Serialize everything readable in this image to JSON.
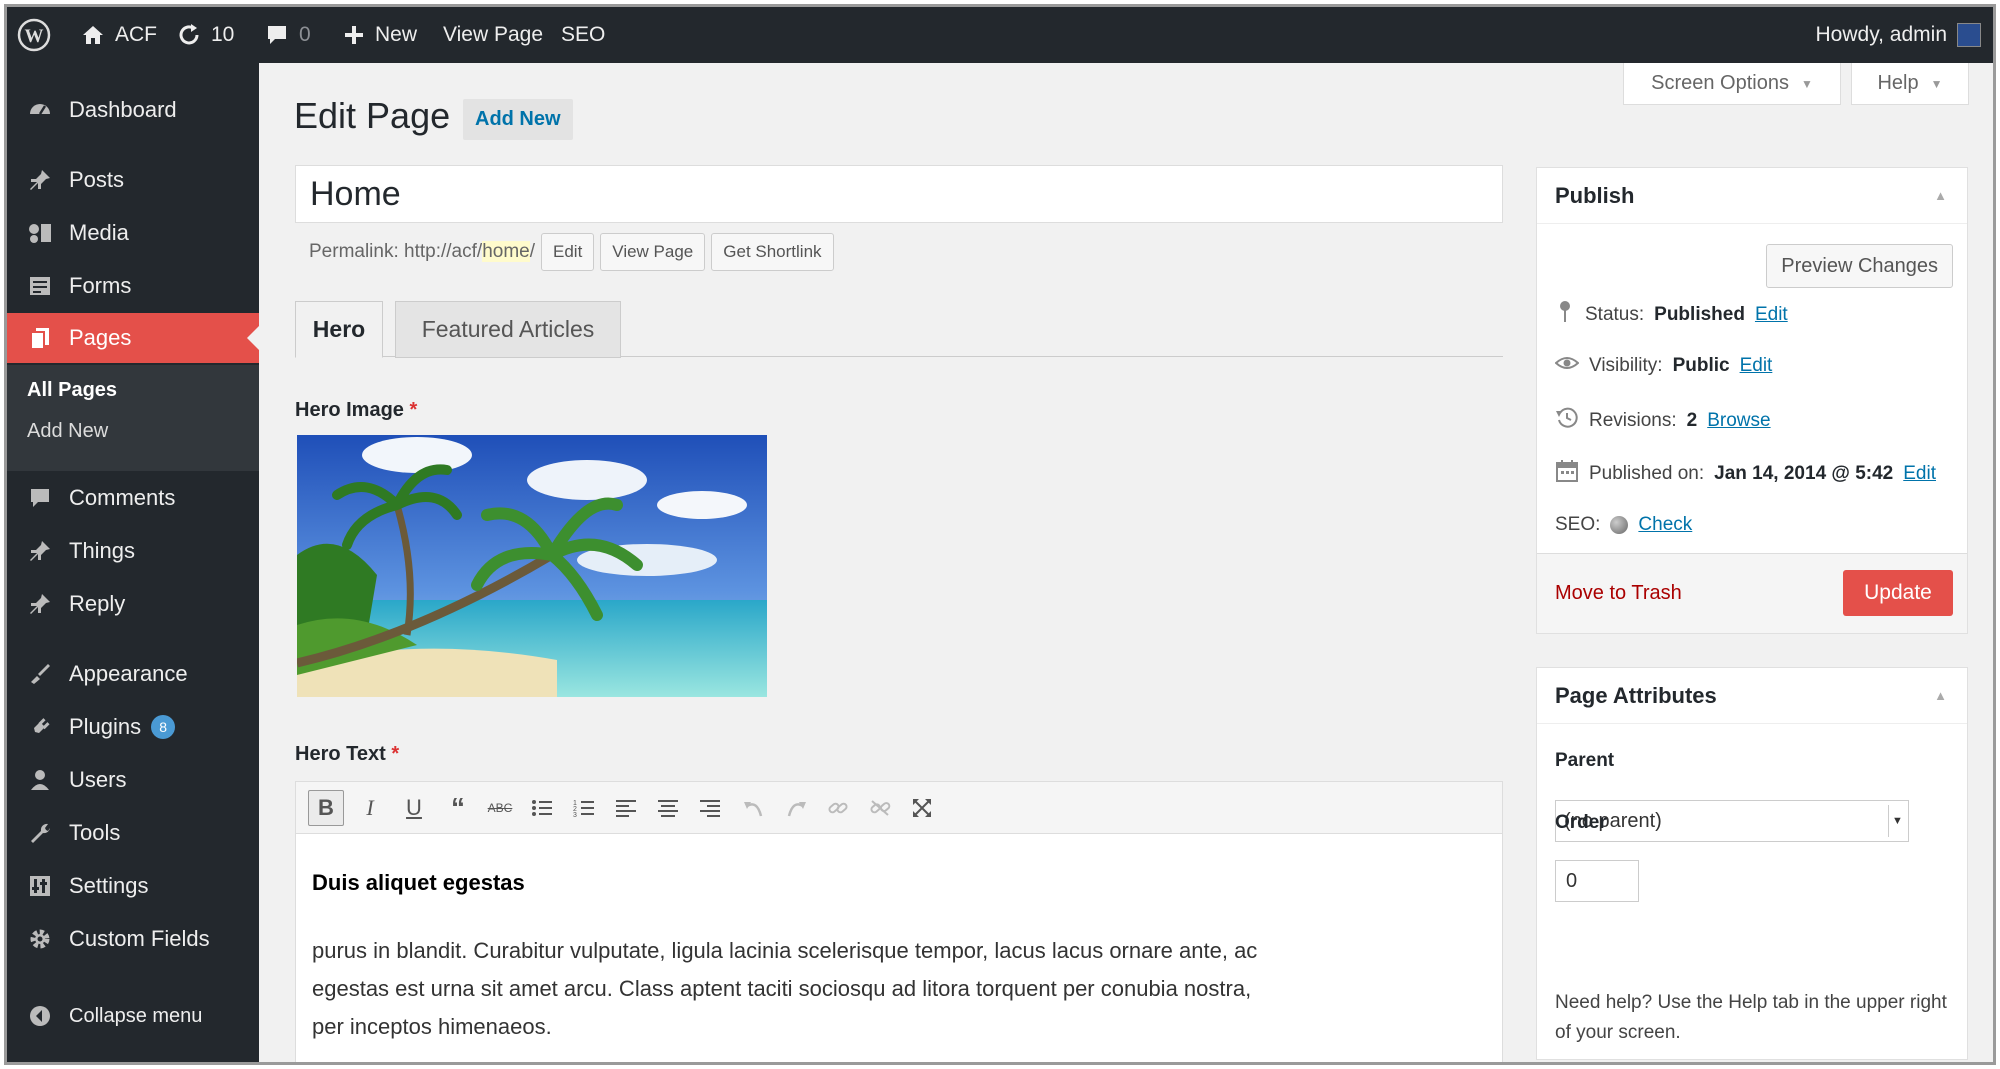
{
  "adminbar": {
    "site_name": "ACF",
    "updates_count": "10",
    "comments_count": "0",
    "new_label": "New",
    "view_page_label": "View Page",
    "seo_label": "SEO",
    "howdy": "Howdy, admin"
  },
  "sidebar": {
    "items": [
      {
        "label": "Dashboard",
        "icon": "dashboard-icon"
      },
      {
        "label": "Posts",
        "icon": "pin-icon"
      },
      {
        "label": "Media",
        "icon": "media-icon"
      },
      {
        "label": "Forms",
        "icon": "forms-icon"
      },
      {
        "label": "Pages",
        "icon": "pages-icon"
      },
      {
        "label": "Comments",
        "icon": "comment-icon"
      },
      {
        "label": "Things",
        "icon": "pin-icon"
      },
      {
        "label": "Reply",
        "icon": "pin-icon"
      },
      {
        "label": "Appearance",
        "icon": "brush-icon"
      },
      {
        "label": "Plugins",
        "icon": "plugin-icon",
        "badge": "8"
      },
      {
        "label": "Users",
        "icon": "user-icon"
      },
      {
        "label": "Tools",
        "icon": "wrench-icon"
      },
      {
        "label": "Settings",
        "icon": "settings-icon"
      },
      {
        "label": "Custom Fields",
        "icon": "gear-icon"
      }
    ],
    "submenu": [
      "All Pages",
      "Add New"
    ],
    "collapse": "Collapse menu"
  },
  "screen_meta": {
    "screen_options": "Screen Options",
    "help": "Help"
  },
  "page": {
    "title": "Edit Page",
    "add_new": "Add New",
    "post_title": "Home",
    "permalink_prefix": "Permalink: http://acf/",
    "permalink_slug": "home",
    "permalink_suffix": "/",
    "edit_btn": "Edit",
    "view_btn": "View Page",
    "shortlink_btn": "Get Shortlink"
  },
  "tabs": [
    "Hero",
    "Featured Articles"
  ],
  "fields": {
    "hero_image_label": "Hero Image",
    "hero_text_label": "Hero Text",
    "required_mark": "*"
  },
  "editor": {
    "heading": "Duis aliquet egestas",
    "body": "purus in blandit. Curabitur vulputate, ligula lacinia scelerisque tempor, lacus lacus ornare ante, ac egestas est urna sit amet arcu. Class aptent taciti sociosqu ad litora torquent per conubia nostra, per inceptos himenaeos."
  },
  "publish": {
    "title": "Publish",
    "preview": "Preview Changes",
    "status_label": "Status:",
    "status_value": "Published",
    "visibility_label": "Visibility:",
    "visibility_value": "Public",
    "revisions_label": "Revisions:",
    "revisions_value": "2",
    "browse": "Browse",
    "published_label": "Published on:",
    "published_value": "Jan 14, 2014 @ 5:42",
    "seo_label": "SEO:",
    "check": "Check",
    "edit": "Edit",
    "trash": "Move to Trash",
    "update": "Update"
  },
  "attributes": {
    "title": "Page Attributes",
    "parent_label": "Parent",
    "parent_value": "(no parent)",
    "order_label": "Order",
    "order_value": "0",
    "help": "Need help? Use the Help tab in the upper right of your screen."
  },
  "colors": {
    "accent": "#e4504a",
    "link": "#0073aa",
    "adminbar": "#23282d",
    "badge": "#4a9ad4"
  }
}
